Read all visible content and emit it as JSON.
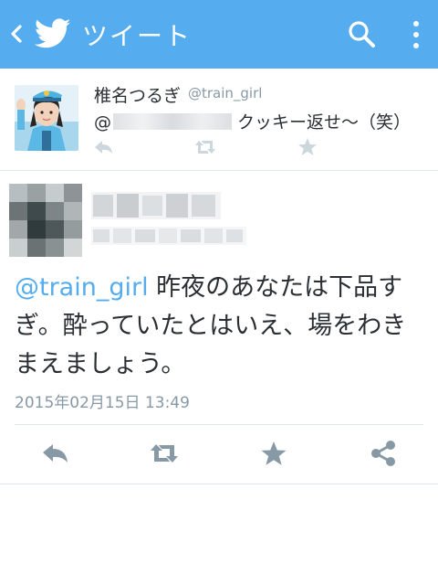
{
  "appbar": {
    "title": "ツイート"
  },
  "parent_tweet": {
    "name": "椎名つるぎ",
    "handle": "@train_girl",
    "text_prefix": "@",
    "text_suffix": "クッキー返せ〜（笑）"
  },
  "main_tweet": {
    "mention": "@train_girl",
    "text": " 昨夜のあなたは下品すぎ。酔っていたとはいえ、場をわきまえましょう。",
    "timestamp": "2015年02月15日 13:49"
  },
  "colors": {
    "accent": "#55acee",
    "icon_gray": "#8899a6",
    "icon_light": "#ccd6dd"
  },
  "icons": [
    "back-icon",
    "twitter-bird-icon",
    "search-icon",
    "more-vertical-icon",
    "reply-icon",
    "retweet-icon",
    "favorite-icon",
    "share-icon"
  ]
}
